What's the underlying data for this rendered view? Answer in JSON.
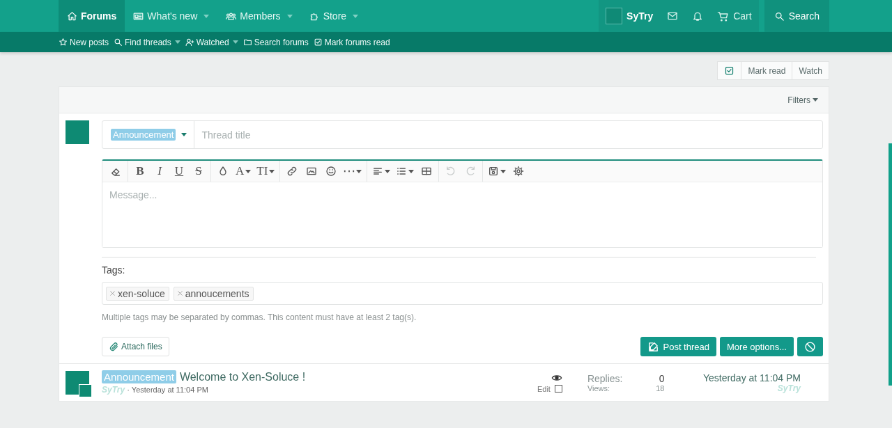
{
  "nav": {
    "items": [
      {
        "label": "Forums",
        "selected": true,
        "menu": false
      },
      {
        "label": "What's new",
        "selected": false,
        "menu": true
      },
      {
        "label": "Members",
        "selected": false,
        "menu": true
      },
      {
        "label": "Store",
        "selected": false,
        "menu": true
      }
    ],
    "user": "SyTry",
    "cart": "Cart",
    "search": "Search"
  },
  "subnav": [
    {
      "label": "New posts",
      "menu": false
    },
    {
      "label": "Find threads",
      "menu": true
    },
    {
      "label": "Watched",
      "menu": true
    },
    {
      "label": "Search forums",
      "menu": false
    },
    {
      "label": "Mark forums read",
      "menu": false
    }
  ],
  "actions": [
    "Mark read",
    "Watch"
  ],
  "filters": "Filters",
  "form": {
    "prefix": "Announcement",
    "title_placeholder": "Thread title",
    "toolbar": [
      [
        {
          "kind": "icon",
          "menu": false,
          "disabled": false
        }
      ],
      [
        {
          "kind": "text",
          "label": "B",
          "menu": false,
          "disabled": false
        },
        {
          "kind": "text",
          "label": "I",
          "menu": false,
          "disabled": false
        },
        {
          "kind": "text",
          "label": "U",
          "menu": false,
          "disabled": false
        },
        {
          "kind": "text",
          "label": "S",
          "menu": false,
          "disabled": false
        }
      ],
      [
        {
          "kind": "icon",
          "menu": false,
          "disabled": false
        },
        {
          "kind": "text",
          "label": "A",
          "menu": true,
          "disabled": false
        },
        {
          "kind": "text",
          "label": "TI",
          "menu": true,
          "disabled": false
        }
      ],
      [
        {
          "kind": "icon",
          "menu": false,
          "disabled": false
        },
        {
          "kind": "icon",
          "menu": false,
          "disabled": false
        },
        {
          "kind": "icon",
          "menu": false,
          "disabled": false
        },
        {
          "kind": "icon",
          "menu": true,
          "disabled": false
        }
      ],
      [
        {
          "kind": "icon",
          "menu": true,
          "disabled": false
        },
        {
          "kind": "icon",
          "menu": true,
          "disabled": false
        },
        {
          "kind": "icon",
          "menu": false,
          "disabled": false
        }
      ],
      [
        {
          "kind": "icon",
          "menu": false,
          "disabled": true
        },
        {
          "kind": "icon",
          "menu": false,
          "disabled": true
        }
      ],
      [
        {
          "kind": "icon",
          "menu": true,
          "disabled": false
        },
        {
          "kind": "icon",
          "menu": false,
          "disabled": false
        }
      ]
    ],
    "message_placeholder": "Message...",
    "tags_label": "Tags:",
    "tags": [
      "xen-soluce",
      "annoucements"
    ],
    "tags_hint": "Multiple tags may be separated by commas. This content must have at least 2 tag(s).",
    "attach": "Attach files",
    "buttons": [
      "Post thread",
      "More options..."
    ]
  },
  "thread": {
    "prefix": "Announcement",
    "title": "Welcome to Xen-Soluce !",
    "author": "SyTry",
    "separator": "·",
    "date": "Yesterday at 11:04 PM",
    "edit": "Edit",
    "checked": false,
    "replies_label": "Replies:",
    "replies": "0",
    "views_label": "Views:",
    "views": "18",
    "last_date": "Yesterday at 11:04 PM",
    "last_user": "SyTry"
  }
}
